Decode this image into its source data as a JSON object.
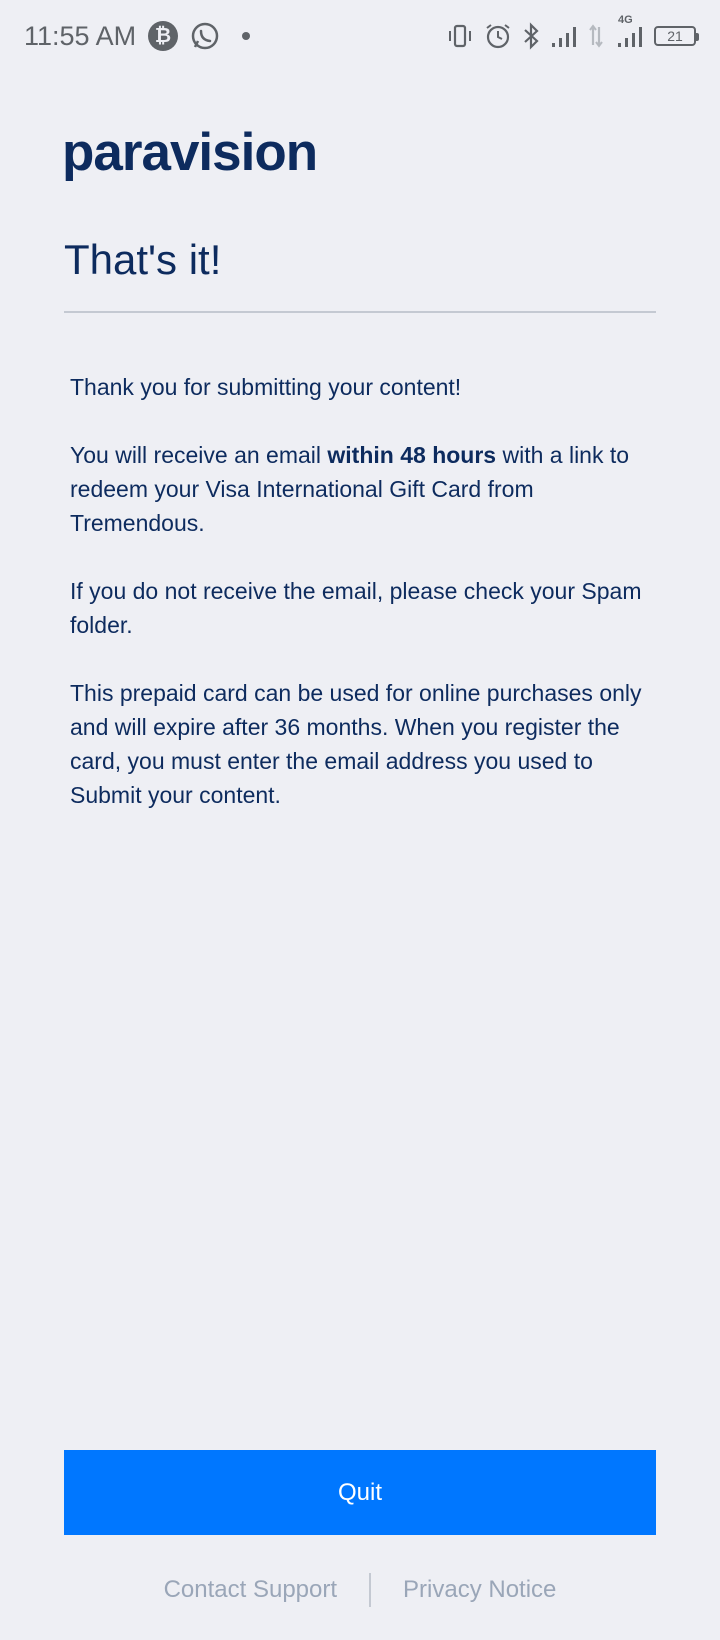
{
  "status_bar": {
    "time": "11:55 AM",
    "notification_icons": [
      "bitcoin-icon",
      "whatsapp-icon",
      "dot-icon"
    ],
    "system_icons": [
      "vibrate-icon",
      "alarm-icon",
      "bluetooth-icon",
      "signal-icon",
      "data-arrows-icon",
      "signal-4g-icon"
    ],
    "network_label": "4G",
    "battery_level": "21"
  },
  "brand": {
    "logo_text": "paravision"
  },
  "main": {
    "heading": "That's it!",
    "para1": "Thank you for submitting your content!",
    "para2_before": "You will receive an email ",
    "para2_bold": "within 48 hours",
    "para2_after": " with a link to redeem your Visa International Gift Card from Tremendous.",
    "para3": "If you do not receive the email, please check your Spam folder.",
    "para4": "This prepaid card can be used for online purchases only and will expire after 36 months. When you register the card, you must enter the email address you used to Submit your content."
  },
  "actions": {
    "quit_label": "Quit"
  },
  "footer": {
    "contact_support": "Contact Support",
    "privacy_notice": "Privacy Notice"
  },
  "colors": {
    "background": "#eeeff4",
    "primary_text": "#0d2b5e",
    "accent": "#0077ff",
    "muted_link": "#9aa6b8"
  }
}
